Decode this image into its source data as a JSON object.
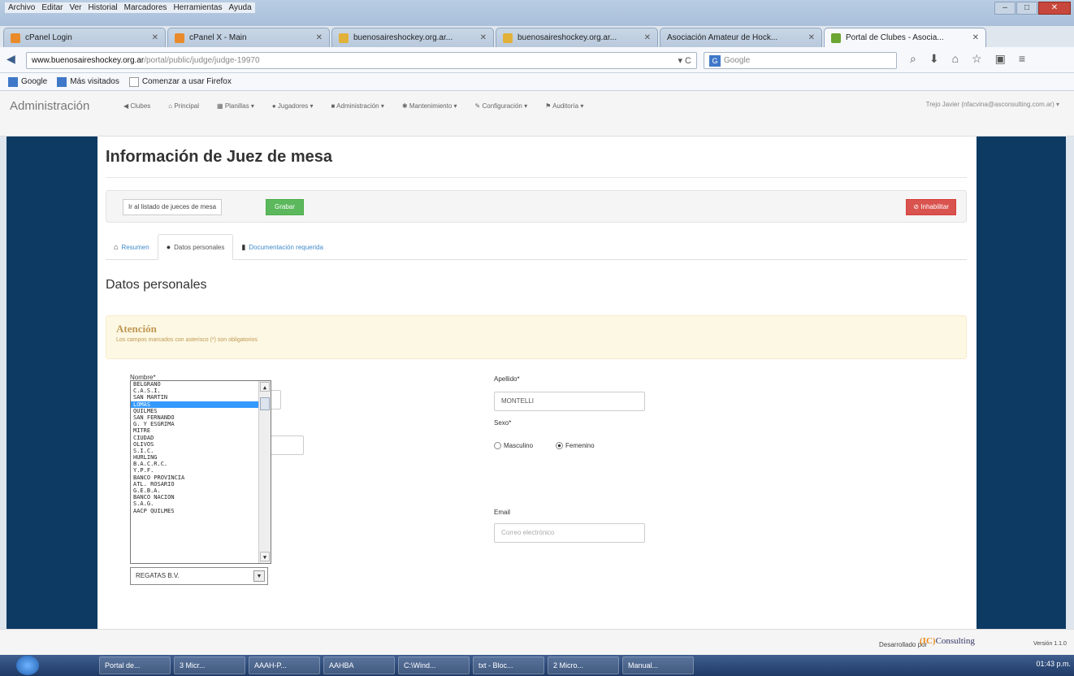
{
  "browser": {
    "menu": [
      "Archivo",
      "Editar",
      "Ver",
      "Historial",
      "Marcadores",
      "Herramientas",
      "Ayuda"
    ],
    "tabs": [
      {
        "label": "cPanel Login",
        "active": false
      },
      {
        "label": "cPanel X - Main",
        "active": false
      },
      {
        "label": "buenosaireshockey.org.ar...",
        "active": false
      },
      {
        "label": "buenosaireshockey.org.ar...",
        "active": false
      },
      {
        "label": "Asociación Amateur de Hock...",
        "active": false
      },
      {
        "label": "Portal de Clubes - Asocia...",
        "active": true
      }
    ],
    "url_host": "www.buenosaireshockey.org.ar",
    "url_path": "/portal/public/judge/judge-19970",
    "search_placeholder": "Google",
    "bookmarks": [
      "Google",
      "Más visitados",
      "Comenzar a usar Firefox"
    ]
  },
  "appnav": {
    "brand": "Administración",
    "items": [
      "Clubes",
      "Principal",
      "Planillas",
      "Jugadores",
      "Administración",
      "Mantenimiento",
      "Configuración",
      "Auditoría"
    ],
    "user": "Trejo Javier (nfacvina@asconsulting.com.ar)"
  },
  "page": {
    "title": "Información de Juez de mesa",
    "back_list_label": "Ir al listado de jueces de mesa",
    "save_label": "Grabar",
    "disable_label": "Inhabilitar",
    "tabs": [
      "Resumen",
      "Datos personales",
      "Documentación requerida"
    ],
    "section_title": "Datos personales",
    "alert_title": "Atención",
    "alert_text": "Los campos marcados con asterisco (*) son obligatorios",
    "first_name_label": "Nombre*",
    "last_name_label": "Apellido*",
    "last_name_value": "MONTELLI",
    "sex_label": "Sexo*",
    "sex_options": [
      "Masculino",
      "Femenino"
    ],
    "sex_selected": "Femenino",
    "email_label": "Email",
    "email_placeholder": "Correo electrónico"
  },
  "club_dropdown": {
    "options": [
      "BELGRANO",
      "C.A.S.I.",
      "SAN MARTIN",
      "LOMAS",
      "QUILMES",
      "SAN FERNANDO",
      "G. Y ESGRIMA",
      "MITRE",
      "CIUDAD",
      "OLIVOS",
      "S.I.C.",
      "HURLING",
      "B.A.C.R.C.",
      "Y.P.F.",
      "BANCO PROVINCIA",
      "ATL. ROSARIO",
      "G.E.B.A.",
      "BANCO NACION",
      "S.A.G.",
      "AACP QUILMES"
    ],
    "highlighted": "LOMAS",
    "selected_value": "REGATAS B.V."
  },
  "footer": {
    "developed_by": "Desarrollado por",
    "company": "Consulting",
    "version": "Versión 1.1.0"
  },
  "taskbar": {
    "tasks": [
      "Portal de...",
      "3 Micr...",
      "AAAH-P...",
      "AAHBA",
      "C:\\Wind...",
      "txt - Bloc...",
      "2 Micro...",
      "Manual..."
    ],
    "tray_time": "01:43 p.m."
  }
}
